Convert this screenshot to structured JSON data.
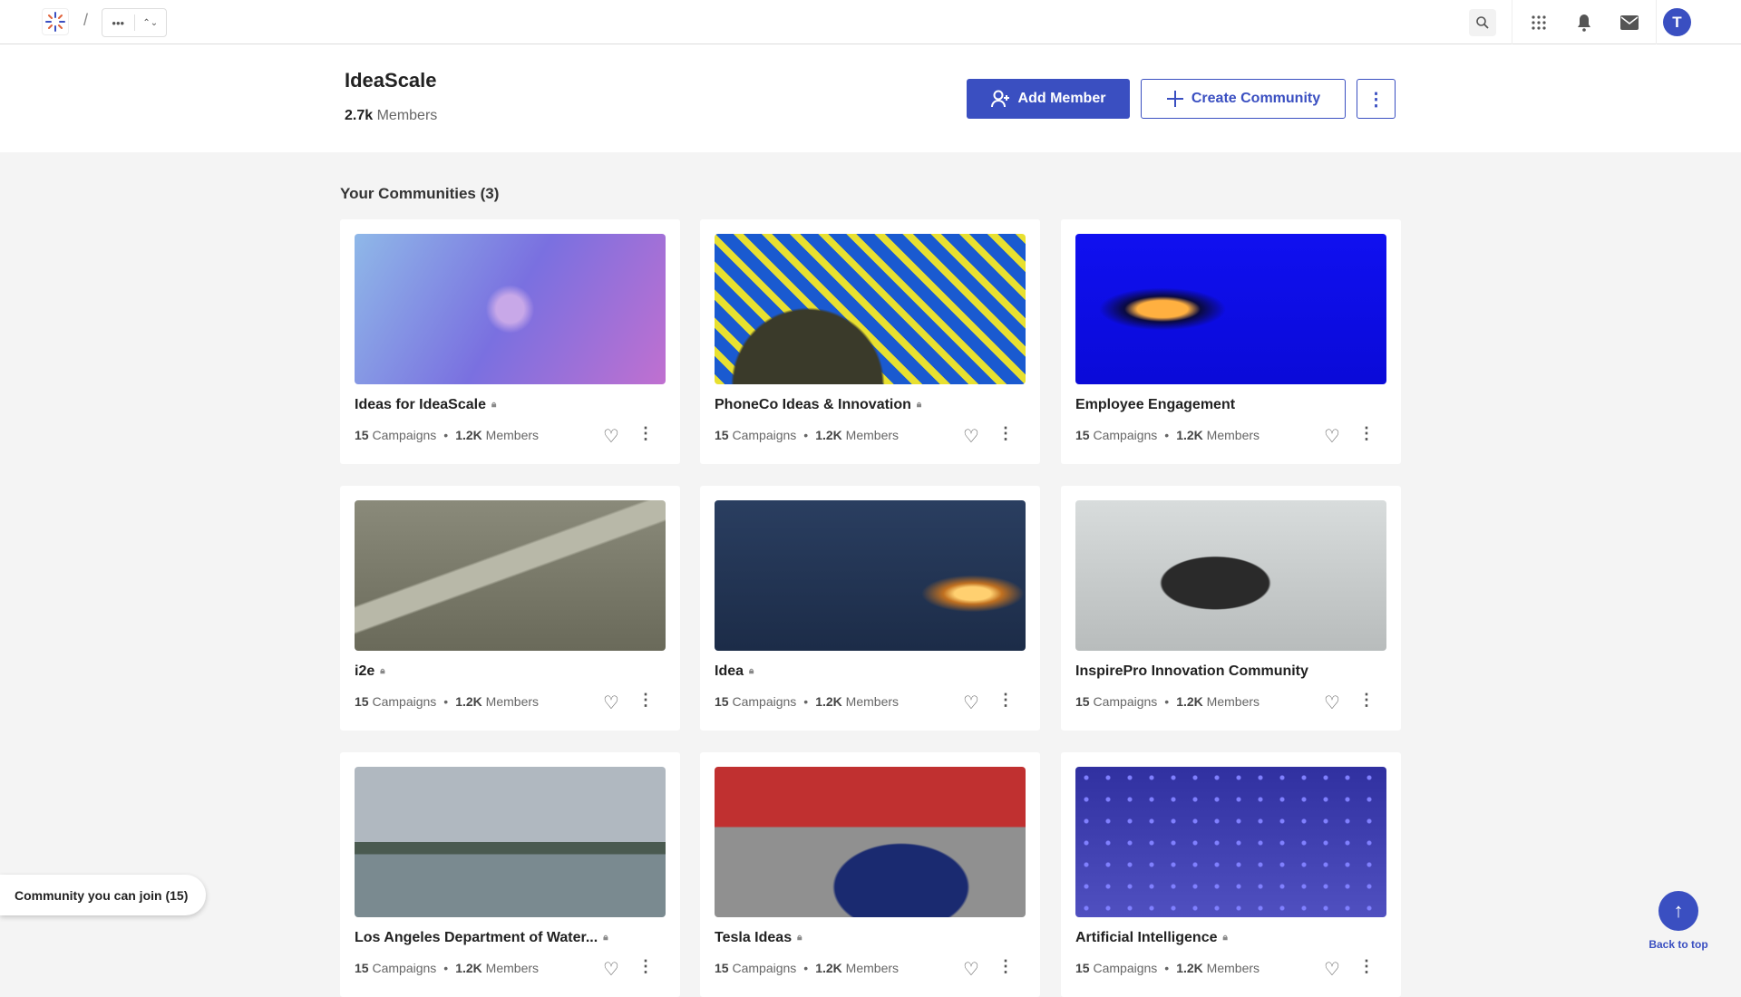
{
  "topbar": {
    "breadcrumb_more": "•••",
    "breadcrumb_switch": "⌃⌄",
    "avatar_initial": "T"
  },
  "header": {
    "title": "IdeaScale",
    "members_count": "2.7k",
    "members_label": "Members",
    "add_member": "Add Member",
    "create_community": "Create Community",
    "more": "⋮"
  },
  "section": {
    "title": "Your Communities (3)"
  },
  "communities": [
    {
      "name": "Ideas for IdeaScale",
      "locked": true,
      "campaigns": "15",
      "members": "1.2K"
    },
    {
      "name": "PhoneCo Ideas & Innovation",
      "locked": true,
      "campaigns": "15",
      "members": "1.2K"
    },
    {
      "name": "Employee Engagement",
      "locked": false,
      "campaigns": "15",
      "members": "1.2K"
    },
    {
      "name": "i2e",
      "locked": true,
      "campaigns": "15",
      "members": "1.2K"
    },
    {
      "name": "Idea",
      "locked": true,
      "campaigns": "15",
      "members": "1.2K"
    },
    {
      "name": "InspirePro Innovation Community",
      "locked": false,
      "campaigns": "15",
      "members": "1.2K"
    },
    {
      "name": "Los Angeles Department of Water...",
      "locked": true,
      "campaigns": "15",
      "members": "1.2K"
    },
    {
      "name": "Tesla Ideas",
      "locked": true,
      "campaigns": "15",
      "members": "1.2K"
    },
    {
      "name": "Artificial Intelligence",
      "locked": true,
      "campaigns": "15",
      "members": "1.2K"
    }
  ],
  "labels": {
    "campaigns": "Campaigns",
    "members": "Members",
    "separator": "•"
  },
  "join": {
    "label": "Community you can join (15)"
  },
  "back_to_top": {
    "label": "Back to top"
  },
  "colors": {
    "accent": "#3a4fc1"
  }
}
